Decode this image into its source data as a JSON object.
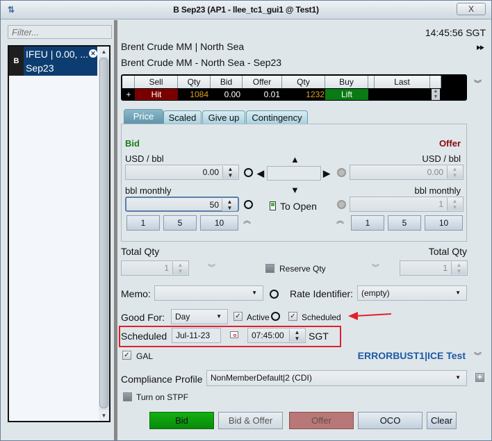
{
  "window": {
    "title": "B Sep23 (AP1 - llee_tc1_gui1 @ Test1)",
    "title_icon": "sort-arrows-icon",
    "close_label": "X"
  },
  "sidebar": {
    "filter_placeholder": "Filter...",
    "items": [
      {
        "side": "B",
        "line1": "IFEU | 0.00, ...",
        "line2": "Sep23"
      }
    ]
  },
  "header": {
    "clock": "14:45:56 SGT",
    "market_name": "Brent Crude MM | North Sea",
    "contract_name": "Brent Crude MM - North Sea - Sep23"
  },
  "market": {
    "columns": [
      "",
      "Sell",
      "Qty",
      "Bid",
      "Offer",
      "Qty",
      "Buy",
      "",
      "Last"
    ],
    "row": {
      "expand": "+",
      "sell": "Hit",
      "bid_qty": "1084",
      "bid": "0.00",
      "offer": "0.01",
      "offer_qty": "1232",
      "buy": "Lift",
      "blank": "",
      "last": ""
    },
    "colors": {
      "hit_bg": "#7a0000",
      "lift_bg": "#0a7a14",
      "qty_fg": "#e0a020"
    }
  },
  "tabs": [
    {
      "label": "Price",
      "active": true
    },
    {
      "label": "Scaled",
      "active": false
    },
    {
      "label": "Give up",
      "active": false
    },
    {
      "label": "Contingency",
      "active": false
    }
  ],
  "price": {
    "bid_title": "Bid",
    "offer_title": "Offer",
    "bid_price_unit": "USD / bbl",
    "bid_price": "0.00",
    "bid_qty_unit": "bbl monthly",
    "bid_qty": "50",
    "offer_price_unit": "USD / bbl",
    "offer_price": "0.00",
    "offer_qty_unit": "bbl monthly",
    "offer_qty": "1",
    "increments": [
      "1",
      "5",
      "10"
    ],
    "to_open_label": "To Open",
    "colors": {
      "bid": "#1a7a1a",
      "offer": "#8a0a0a"
    }
  },
  "totals": {
    "total_qty_label": "Total Qty",
    "bid_total_qty": "1",
    "offer_total_qty": "1",
    "reserve_qty_label": "Reserve Qty"
  },
  "memo": {
    "label": "Memo:",
    "value": "",
    "rate_identifier_label": "Rate Identifier:",
    "rate_identifier_value": "(empty)"
  },
  "good_for": {
    "label": "Good For:",
    "value": "Day",
    "active_label": "Active",
    "active_checked": true,
    "scheduled_label": "Scheduled",
    "scheduled_checked": true
  },
  "scheduled": {
    "label": "Scheduled",
    "date": "Jul-11-23",
    "time": "07:45:00",
    "tz": "SGT"
  },
  "gal": {
    "label": "GAL",
    "checked": true,
    "account": "ERRORBUST1|ICE Test"
  },
  "compliance": {
    "label": "Compliance Profile",
    "value": "NonMemberDefault|2 (CDI)"
  },
  "stpf": {
    "label": "Turn on STPF",
    "checked": false
  },
  "actions": {
    "bid": "Bid",
    "bid_offer": "Bid & Offer",
    "offer": "Offer",
    "oco": "OCO",
    "clear": "Clear"
  }
}
